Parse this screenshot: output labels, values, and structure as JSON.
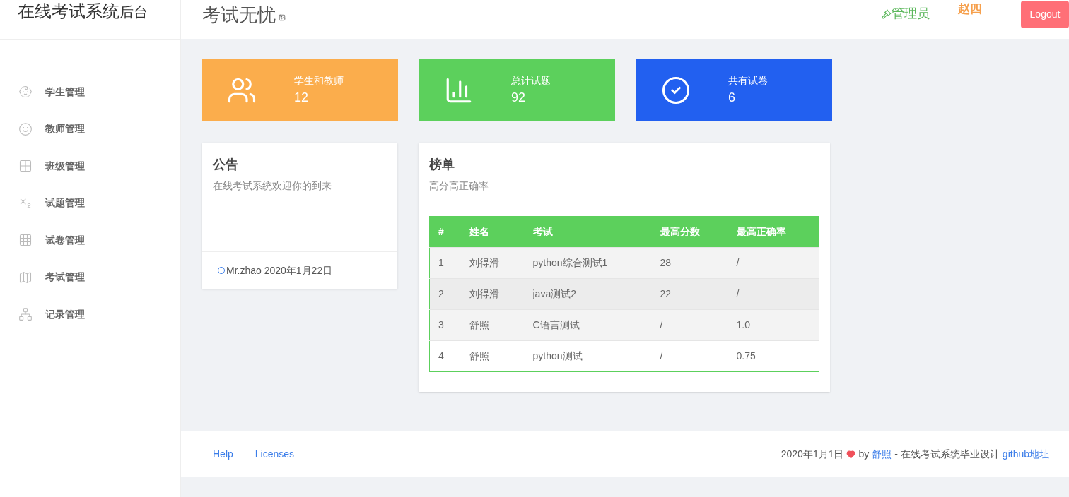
{
  "brand": {
    "title": "在线考试系统",
    "suffix": "后台"
  },
  "header": {
    "title": "考试无忧",
    "role": "管理员",
    "user": "赵四",
    "logout": "Logout"
  },
  "sidebar": {
    "items": [
      {
        "label": "学生管理"
      },
      {
        "label": "教师管理"
      },
      {
        "label": "班级管理"
      },
      {
        "label": "试题管理"
      },
      {
        "label": "试卷管理"
      },
      {
        "label": "考试管理"
      },
      {
        "label": "记录管理"
      }
    ]
  },
  "stats": [
    {
      "label": "学生和教师",
      "value": "12",
      "color": "#fbad4c"
    },
    {
      "label": "总计试题",
      "value": "92",
      "color": "#5cd05c"
    },
    {
      "label": "共有试卷",
      "value": "6",
      "color": "#2260f0"
    }
  ],
  "notice": {
    "title": "公告",
    "subtitle": "在线考试系统欢迎你的到来",
    "entry": "Mr.zhao 2020年1月22日"
  },
  "ranking": {
    "title": "榜单",
    "subtitle": "高分高正确率",
    "columns": [
      "#",
      "姓名",
      "考试",
      "最高分数",
      "最高正确率"
    ],
    "rows": [
      [
        "1",
        "刘得滑",
        "python综合测试1",
        "28",
        "/"
      ],
      [
        "2",
        "刘得滑",
        "java测试2",
        "22",
        "/"
      ],
      [
        "3",
        "舒照",
        "C语言测试",
        "/",
        "1.0"
      ],
      [
        "4",
        "舒照",
        "python测试",
        "/",
        "0.75"
      ]
    ]
  },
  "footer": {
    "links": [
      "Help",
      "Licenses"
    ],
    "date": "2020年1月1日",
    "by": "by",
    "author": "舒照",
    "note": "- 在线考试系统毕业设计",
    "repo": "github地址"
  }
}
